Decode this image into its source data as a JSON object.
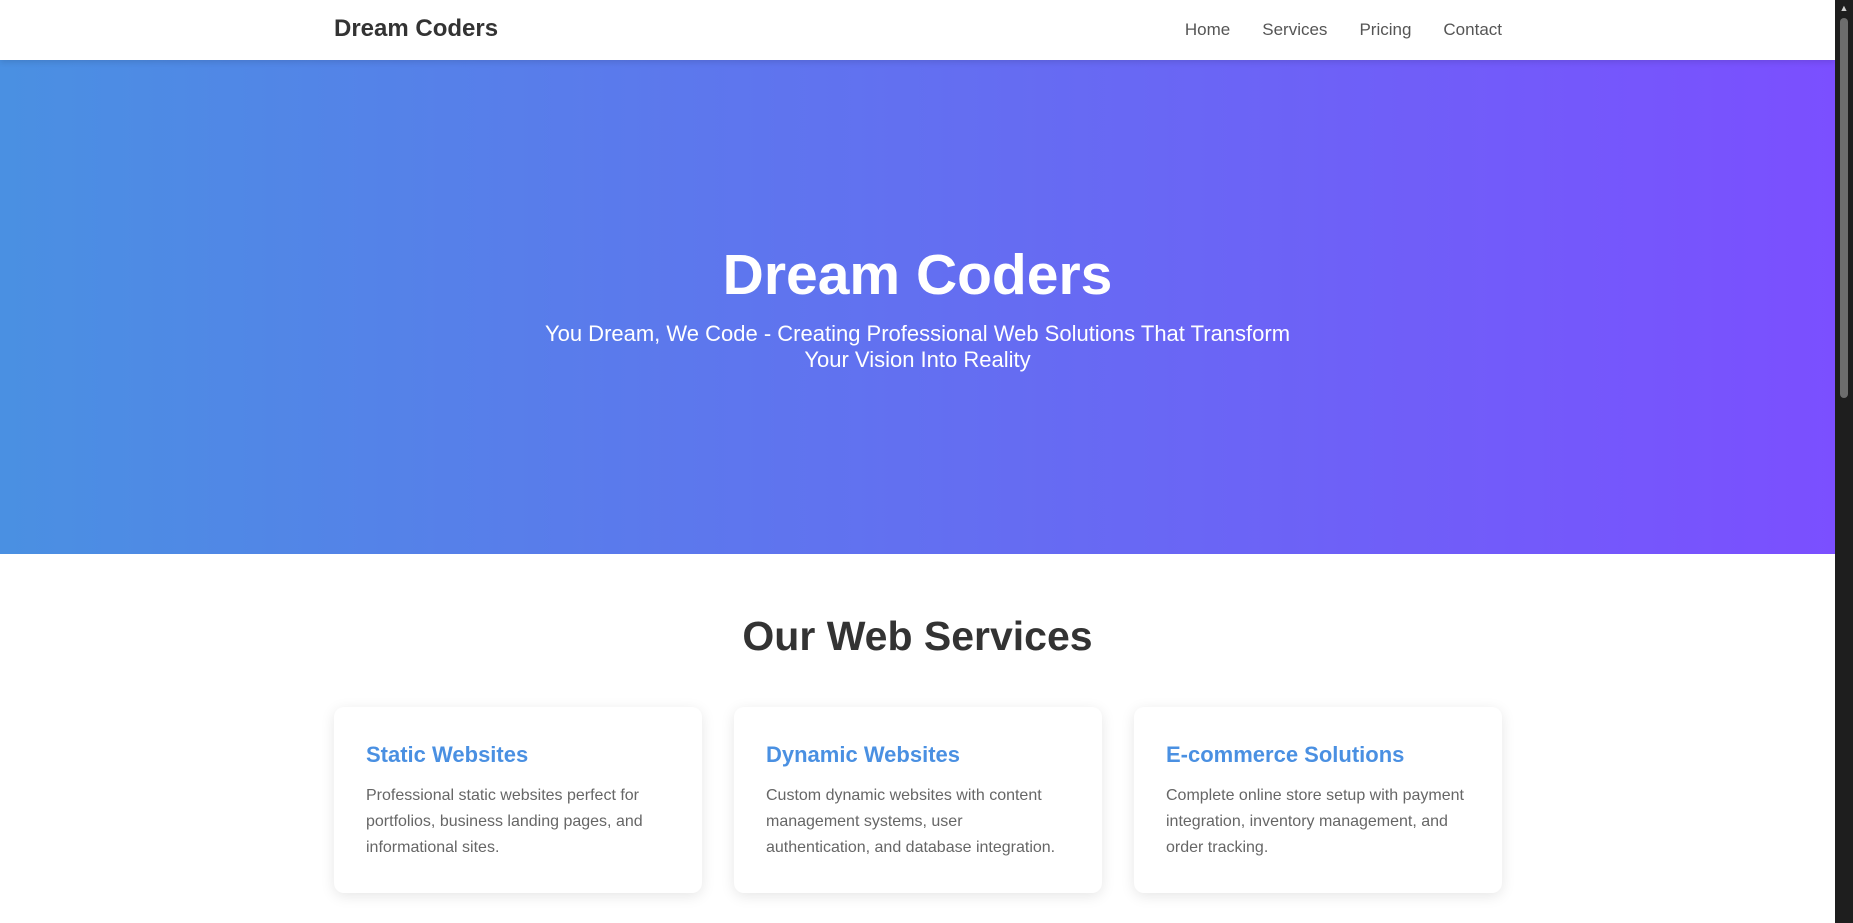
{
  "header": {
    "brand": "Dream Coders",
    "nav": [
      "Home",
      "Services",
      "Pricing",
      "Contact"
    ]
  },
  "hero": {
    "title": "Dream Coders",
    "subtitle": "You Dream, We Code - Creating Professional Web Solutions That Transform Your Vision Into Reality",
    "gradient_start": "#4a90e2",
    "gradient_end": "#7b4fff"
  },
  "services": {
    "title": "Our Web Services",
    "cards": [
      {
        "title": "Static Websites",
        "text": "Professional static websites perfect for portfolios, business landing pages, and informational sites."
      },
      {
        "title": "Dynamic Websites",
        "text": "Custom dynamic websites with content management systems, user authentication, and database integration."
      },
      {
        "title": "E-commerce Solutions",
        "text": "Complete online store setup with payment integration, inventory management, and order tracking."
      }
    ]
  },
  "colors": {
    "accent": "#4a90e2",
    "heading": "#333333",
    "body_text": "#666666",
    "nav_text": "#555555"
  },
  "icons": {
    "scroll_up": "chevron-up-icon"
  }
}
